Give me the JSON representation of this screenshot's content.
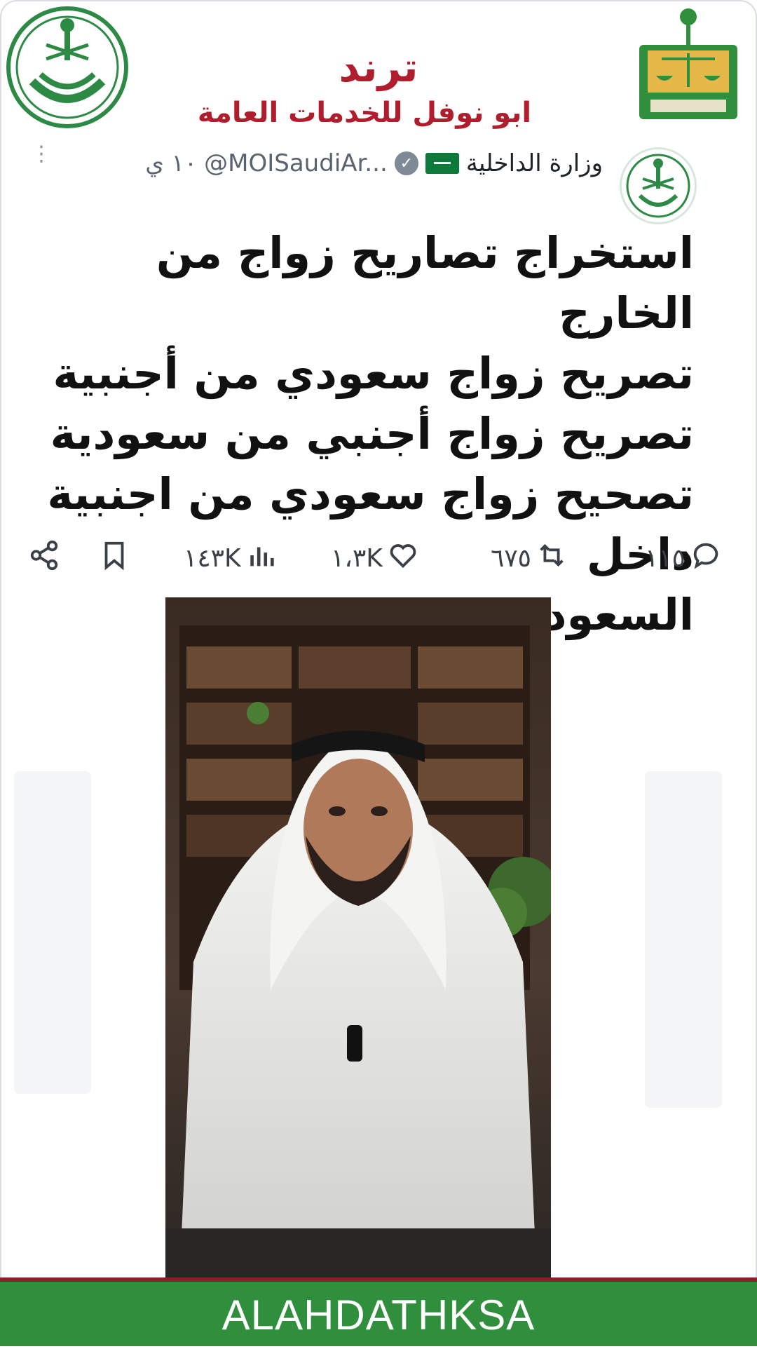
{
  "header": {
    "trend_title": "ترند",
    "trend_subtitle": "ابو نوفل للخدمات العامة",
    "left_emblem": "ministry-of-interior-emblem",
    "right_emblem": "ministry-of-justice-emblem"
  },
  "tweet": {
    "author_name": "وزارة الداخلية",
    "handle": "@MOISaudiAr...",
    "time": "١٠ ي",
    "lines": [
      "استخراج تصاريح زواج من الخارج",
      "تصريح زواج سعودي من أجنبية",
      "تصريح زواج أجنبي من سعودية",
      "تصحيح زواج سعودي من اجنبية داخل",
      "السعودية"
    ],
    "stats": {
      "replies": "١١٥",
      "retweets": "٦٧٥",
      "likes": "١،٣K",
      "views": "١٤٣K"
    }
  },
  "footer": {
    "watermark": "ALAHDATHKSA"
  },
  "colors": {
    "brand_red": "#b01e2e",
    "footer_green": "#2f8f3c",
    "footer_rule": "#8a1f28"
  }
}
